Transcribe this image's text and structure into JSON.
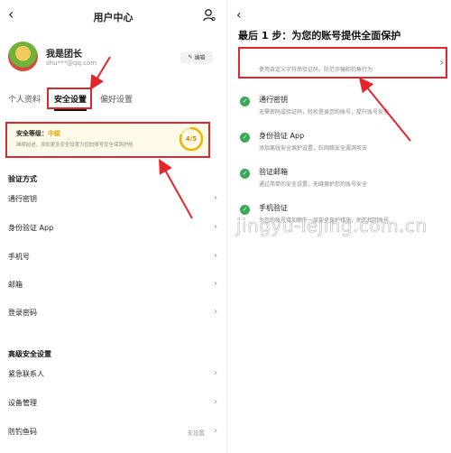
{
  "left": {
    "title": "用户中心",
    "profile": {
      "name": "我是团长",
      "email": "shu***@qq.com",
      "edit_label": "编辑"
    },
    "tabs": [
      {
        "label": "个人资料",
        "active": false
      },
      {
        "label": "安全设置",
        "active": true
      },
      {
        "label": "偏好设置",
        "active": false
      }
    ],
    "security": {
      "label": "安全等级：",
      "level": "中级",
      "desc": "继续前进，添加更多安全设置为您的账号安全保驾护航",
      "score": "4/5",
      "score_fraction": 0.8
    },
    "verify_head": "验证方式",
    "verify_rows": [
      "通行密钥",
      "身份验证 App",
      "手机号",
      "邮箱",
      "登录密码"
    ],
    "advanced_head": "高级安全设置",
    "advanced_rows": [
      {
        "label": "紧急联系人",
        "value": ""
      },
      {
        "label": "设备管理",
        "value": ""
      },
      {
        "label": "防钓鱼码",
        "value": "未设置"
      }
    ]
  },
  "right": {
    "title": "最后 1 步：为您的账号提供全面保护",
    "first_item_title": "",
    "first_item_desc": "使用自定义字符串验证码，防范诈骗和钓鱼行为",
    "items": [
      {
        "title": "通行密钥",
        "desc": "无需密码或验证码，轻松登录您的账号，提升账号安全"
      },
      {
        "title": "身份验证 App",
        "desc": "添加离线安全保护设置，抗网络安全漏洞攻击"
      },
      {
        "title": "验证邮箱",
        "desc": "通过简单的安全设置，无缝保护您的账号安全"
      },
      {
        "title": "手机验证",
        "desc": "为您的账号增加额外一层安全保护措施，助您找回账号"
      }
    ]
  },
  "watermark": "jingyu-lejing.com.cn",
  "colors": {
    "annotation_red": "#e3262c",
    "level_gold": "#e5a500",
    "check_green": "#3aa857"
  },
  "icons": [
    "back-arrow-icon",
    "user-settings-icon",
    "edit-icon",
    "chevron-right-icon",
    "check-circle-icon"
  ]
}
